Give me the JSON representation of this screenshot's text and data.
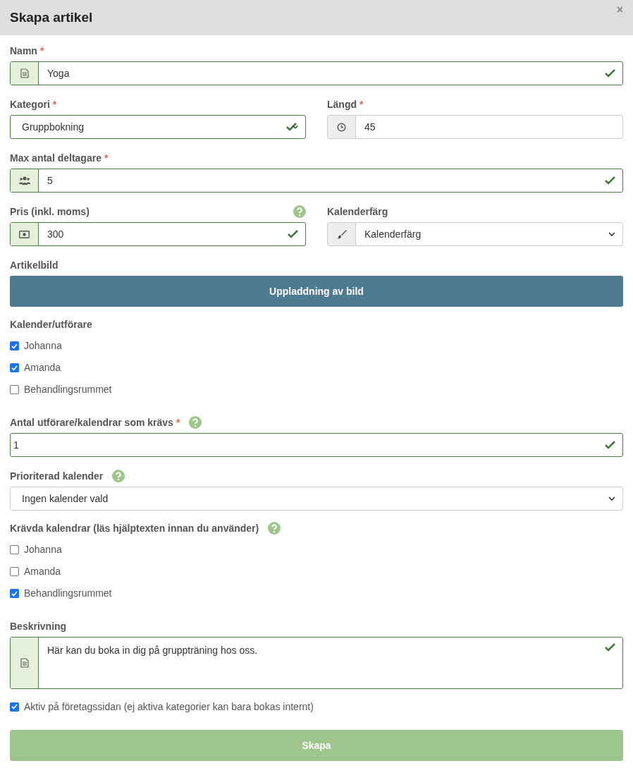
{
  "dialog": {
    "title": "Skapa artikel",
    "close": "×"
  },
  "rows": [
    {
      "fields": [
        {
          "kind": "input",
          "label": "Namn",
          "required_mark": "*",
          "help": false,
          "value": "Yoga",
          "valid": true
        }
      ]
    },
    {
      "fields": [
        {
          "kind": "select",
          "label": "Kategori",
          "required_mark": "*",
          "help": false,
          "value": "Gruppbokning",
          "valid": true
        },
        {
          "kind": "input",
          "label": "Längd",
          "required_mark": "*",
          "help": false,
          "value": "45",
          "valid": false
        }
      ]
    },
    {
      "fields": [
        {
          "kind": "input",
          "label": "Max antal deltagare",
          "required_mark": "*",
          "help": false,
          "value": "5",
          "valid": true
        }
      ]
    },
    {
      "fields": [
        {
          "kind": "input",
          "label": "Pris (inkl. moms)",
          "help": true,
          "value": "300",
          "valid": true
        },
        {
          "kind": "select",
          "label": "Kalenderfärg",
          "help": false,
          "value": "Kalenderfärg",
          "valid": false
        }
      ]
    },
    {
      "fields": [
        {
          "kind": "upload",
          "label": "Artikelbild",
          "button": "Uppladdning av bild"
        }
      ]
    },
    {
      "fields": [
        {
          "kind": "checklist",
          "label": "Kalender/utförare",
          "help": false,
          "items": [
            {
              "label": "Johanna",
              "checked": true
            },
            {
              "label": "Amanda",
              "checked": true
            },
            {
              "label": "Behandlingsrummet",
              "checked": false
            }
          ]
        }
      ]
    },
    {
      "fields": [
        {
          "kind": "input",
          "label": "Antal utförare/kalendrar som krävs",
          "required_mark": "*",
          "help": true,
          "value": "1",
          "valid": true
        }
      ]
    },
    {
      "fields": [
        {
          "kind": "select",
          "label": "Prioriterad kalender",
          "help": true,
          "value": "Ingen kalender vald",
          "valid": false
        }
      ]
    },
    {
      "fields": [
        {
          "kind": "checklist",
          "label": "Krävda kalendrar (läs hjälptexten innan du använder)",
          "help": true,
          "items": [
            {
              "label": "Johanna",
              "checked": false
            },
            {
              "label": "Amanda",
              "checked": false
            },
            {
              "label": "Behandlingsrummet",
              "checked": true
            }
          ]
        }
      ]
    },
    {
      "fields": [
        {
          "kind": "textarea",
          "label": "Beskrivning",
          "help": false,
          "value": "Här kan du boka in dig på gruppträning hos oss.",
          "valid": true
        }
      ]
    },
    {
      "fields": [
        {
          "kind": "checkbox",
          "label": "Aktiv på företagssidan (ej aktiva kategorier kan bara bokas internt)",
          "checked": true
        }
      ]
    },
    {
      "fields": [
        {
          "kind": "submit",
          "button": "Skapa"
        }
      ]
    }
  ]
}
